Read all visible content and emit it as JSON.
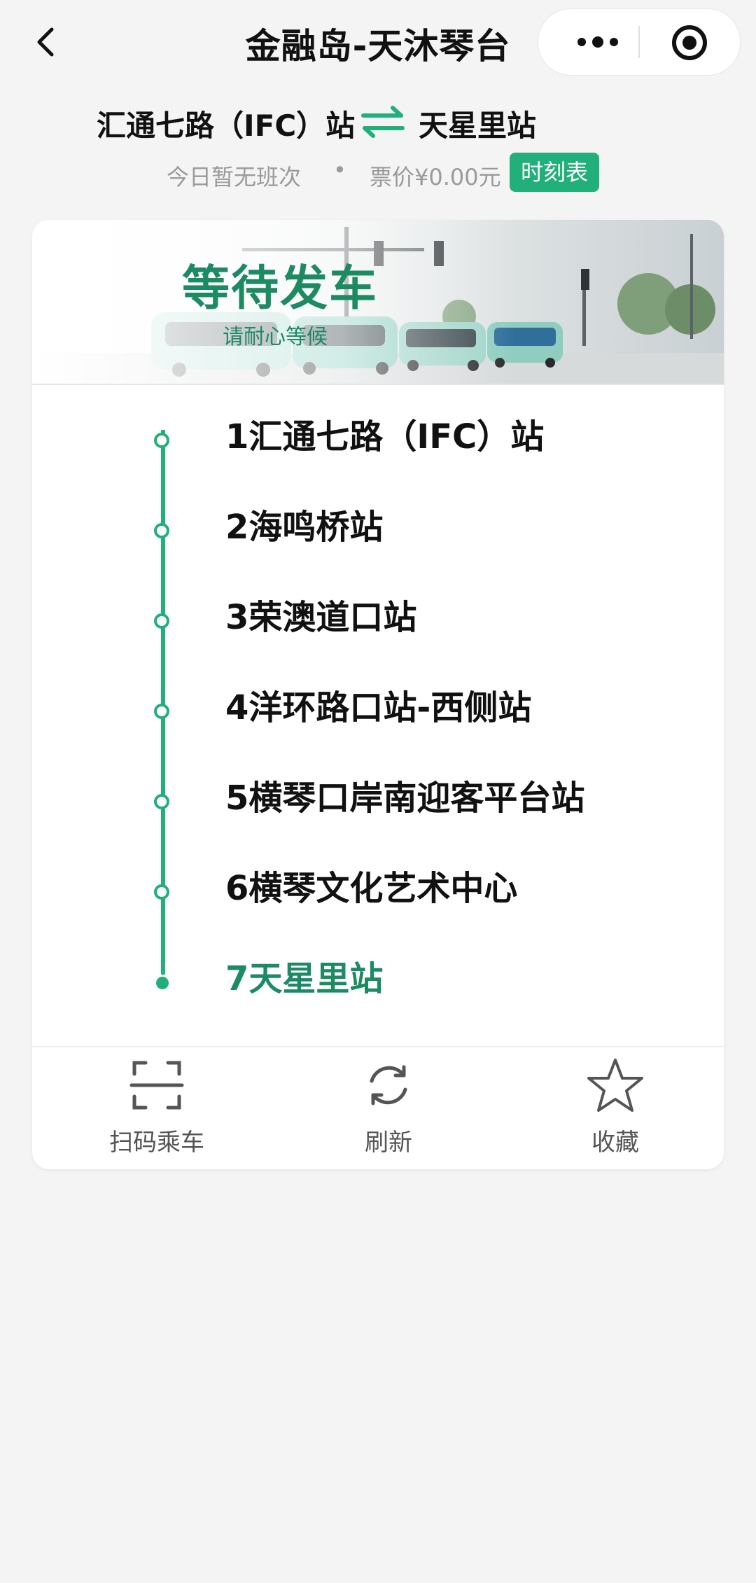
{
  "nav": {
    "title": "金融岛-天沐琴台",
    "back_icon": "chevron-left-icon",
    "more_icon": "more-dots-icon",
    "target_icon": "target-icon"
  },
  "route": {
    "from": "汇通七路（IFC）站",
    "to": "天星里站",
    "swap_icon": "swap-arrows-icon"
  },
  "info": {
    "today": "今日暂无班次",
    "separator": "•",
    "price": "票价¥0.00元",
    "schedule_button": "时刻表"
  },
  "banner": {
    "title": "等待发车",
    "subtitle": "请耐心等候"
  },
  "stops": [
    {
      "label": "1汇通七路（IFC）站",
      "active": false
    },
    {
      "label": "2海鸣桥站",
      "active": false
    },
    {
      "label": "3荣澳道口站",
      "active": false
    },
    {
      "label": "4洋环路口站-西侧站",
      "active": false
    },
    {
      "label": "5横琴口岸南迎客平台站",
      "active": false
    },
    {
      "label": "6横琴文化艺术中心",
      "active": false
    },
    {
      "label": "7天星里站",
      "active": true
    }
  ],
  "actions": {
    "scan": {
      "label": "扫码乘车",
      "icon": "scan-icon"
    },
    "refresh": {
      "label": "刷新",
      "icon": "refresh-icon"
    },
    "favorite": {
      "label": "收藏",
      "icon": "star-icon"
    }
  },
  "colors": {
    "accent": "#22b07a",
    "accent_dark": "#1c8a63",
    "background": "#f4f4f4"
  }
}
